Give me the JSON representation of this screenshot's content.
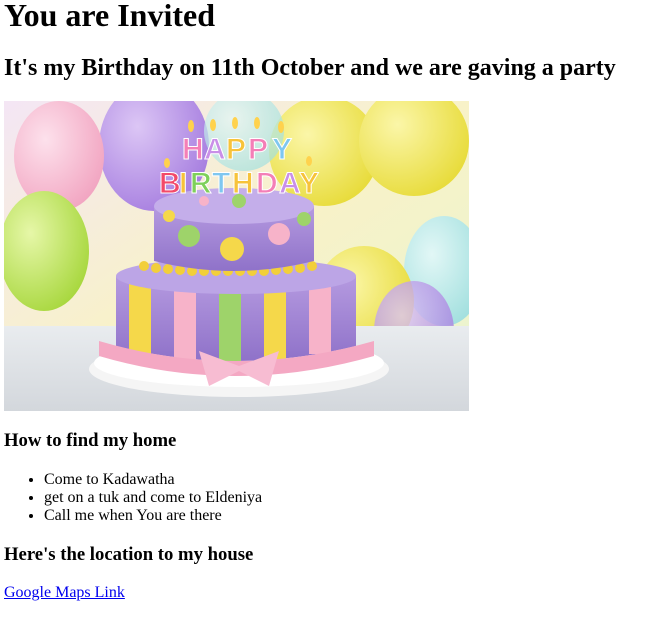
{
  "heading": "You are Invited",
  "subheading": "It's my Birthday on 11th October and we are gaving a party",
  "image": {
    "description": "birthday-cake-photo",
    "candle_text_line1": "HAPPY",
    "candle_text_line2": "BIRTHDAY"
  },
  "directions": {
    "title": "How to find my home",
    "steps": [
      "Come to Kadawatha",
      "get on a tuk and come to Eldeniya",
      "Call me when You are there"
    ]
  },
  "location": {
    "title": "Here's the location to my house",
    "link_text": "Google Maps Link"
  },
  "colors": {
    "link": "#0000ee",
    "cake_purple": "#a58bd6",
    "cake_yellow": "#f5d84a",
    "cake_pink": "#f7b3c9",
    "cake_green": "#9ed36a"
  }
}
